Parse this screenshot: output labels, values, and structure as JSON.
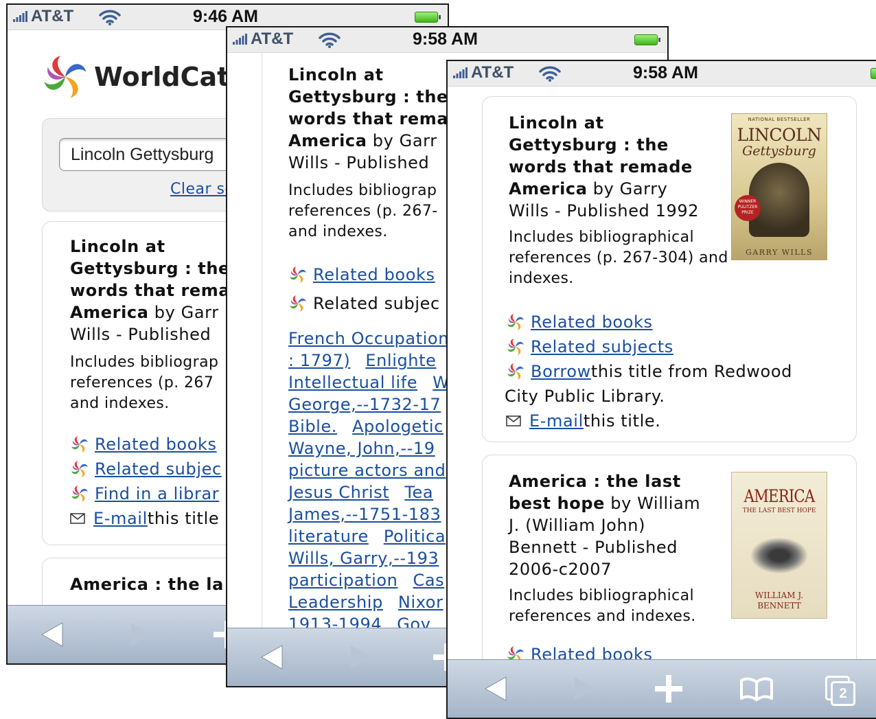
{
  "status": {
    "carrier": "AT&T",
    "time_s1": "9:46 AM",
    "time_s2": "9:58 AM",
    "time_s3": "9:58 AM"
  },
  "search": {
    "logo_text": "WorldCat",
    "logo_reg": "®",
    "query": "Lincoln Gettysburg",
    "clear_label": "Clear se"
  },
  "result1": {
    "title": "Lincoln at Gettysburg : the words that remade America",
    "by": "by",
    "author": "Garry Wills",
    "published_label": "- Published",
    "year": "1992",
    "description": "Includes bibliographical references (p. 267-304) and indexes."
  },
  "result2": {
    "title": "America : the last best hope",
    "by": "by",
    "author": "William J. (William John) Bennett",
    "published_label": "- Published",
    "year": "2006-c2007",
    "description": "Includes bibliographical references and indexes.",
    "cover_title": "AMERICA",
    "cover_subtitle": "THE LAST BEST HOPE",
    "cover_author": "WILLIAM J. BENNETT"
  },
  "cover1": {
    "top": "NATIONAL BESTSELLER",
    "title": "LINCOLN",
    "subtitle": "Gettysburg",
    "badge": "WINNER PULITZER PRIZE",
    "author": "GARRY WILLS"
  },
  "s1": {
    "t1": "Lincoln at",
    "t2": "Gettysburg : the",
    "t3": "words that rema",
    "t4a": "America",
    "t4b": " by Garr",
    "t5": "Wills - Published",
    "d1": "Includes bibliograp",
    "d2": "references (p. 267",
    "d3": "and indexes.",
    "l1": "Related books",
    "l2": "Related subjec",
    "l3": "Find in a librar",
    "l4": "E-mail",
    "l4b": " this title",
    "next_title": "America : the la"
  },
  "s2": {
    "t1": "Lincoln at",
    "t2": "Gettysburg : the",
    "t3": "words that rema",
    "t4a": "America",
    "t4b": " by Garr",
    "t5": "Wills - Published",
    "d1": "Includes bibliograp",
    "d2": "references (p. 267-",
    "d3": "and indexes.",
    "l1": "Related books",
    "l2": "Related subjec",
    "subjects": [
      [
        "French Occupation",
        ""
      ],
      [
        ": 1797)",
        "Enlighte"
      ],
      [
        "Intellectual life",
        "W"
      ],
      [
        "George,--1732-17",
        ""
      ],
      [
        "Bible.",
        "Apologetic"
      ],
      [
        "Wayne, John,--19",
        ""
      ],
      [
        "picture actors and",
        ""
      ],
      [
        "Jesus Christ",
        "Tea"
      ],
      [
        "James,--1751-183",
        ""
      ],
      [
        "literature",
        "Politica"
      ],
      [
        "Wills, Garry,--193",
        ""
      ],
      [
        "participation",
        "Cas"
      ],
      [
        "Leadership",
        "Nixor"
      ],
      [
        "1913-1994",
        "Gov"
      ]
    ]
  },
  "s3": {
    "l1": "Related books",
    "l2": "Related subjects",
    "l3": "Borrow",
    "l3b": " this title from Redwood",
    "l3c": "City Public Library.",
    "l4": "E-mail",
    "l4b": " this title.",
    "r2_link": "Related books"
  },
  "toolbar": {
    "tabs_count": "2"
  },
  "colors": {
    "link": "#1a4fa0",
    "toolbar_top": "#cfd8e4",
    "toolbar_bottom": "#a4b4c8"
  }
}
